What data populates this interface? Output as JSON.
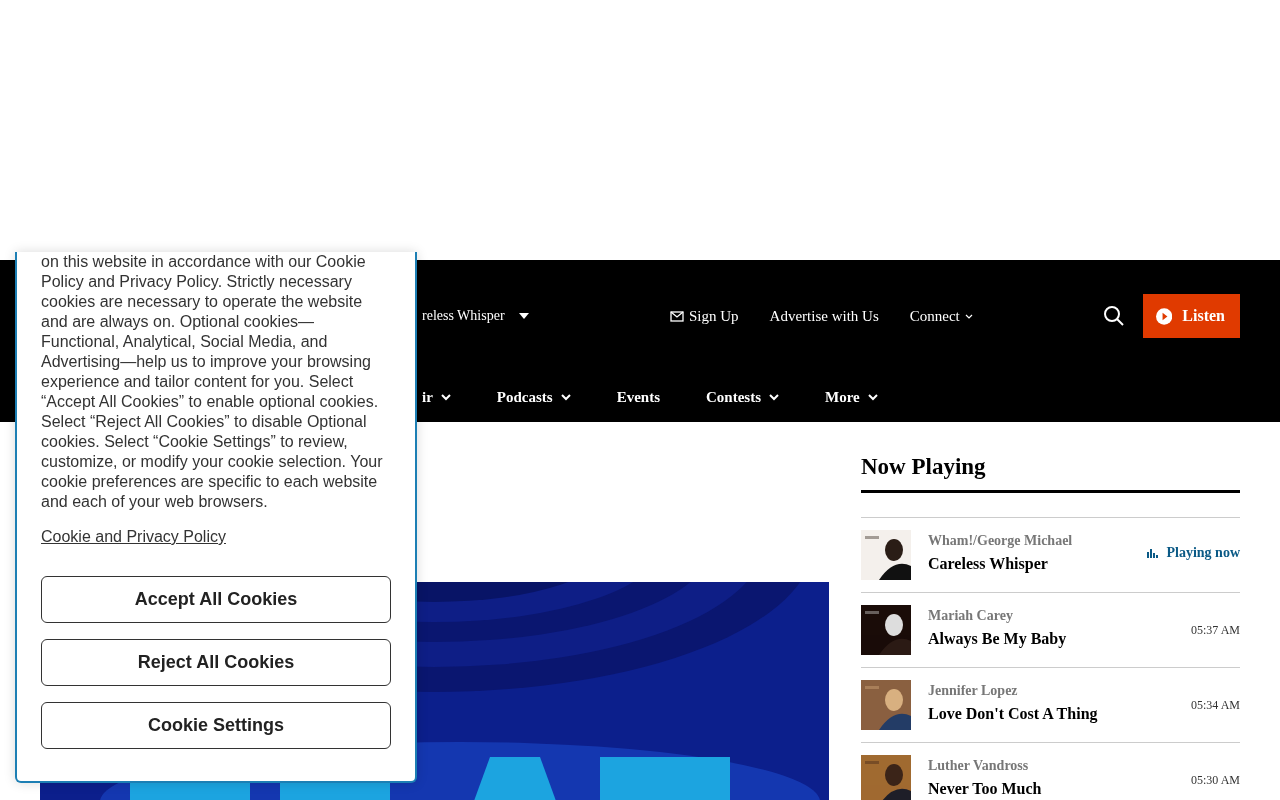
{
  "header": {
    "track": "reless Whisper",
    "links": [
      {
        "label": "Sign Up",
        "has_icon": true,
        "dropdown": false
      },
      {
        "label": "Advertise with Us",
        "has_icon": false,
        "dropdown": false
      },
      {
        "label": "Connect",
        "has_icon": false,
        "dropdown": true
      }
    ],
    "listen_button": "Listen"
  },
  "nav": [
    {
      "label": "ir",
      "dropdown": true
    },
    {
      "label": "Podcasts",
      "dropdown": true
    },
    {
      "label": "Events",
      "dropdown": false
    },
    {
      "label": "Contests",
      "dropdown": true
    },
    {
      "label": "More",
      "dropdown": true
    }
  ],
  "now_playing": {
    "title": "Now Playing",
    "tracks": [
      {
        "artist": "Wham!/George Michael",
        "title": "Careless Whisper",
        "playing": true,
        "status": "Playing now"
      },
      {
        "artist": "Mariah Carey",
        "title": "Always Be My Baby",
        "playing": false,
        "status": "05:37 AM"
      },
      {
        "artist": "Jennifer Lopez",
        "title": "Love Don't Cost A Thing",
        "playing": false,
        "status": "05:34 AM"
      },
      {
        "artist": "Luther Vandross",
        "title": "Never Too Much",
        "playing": false,
        "status": "05:30 AM"
      }
    ]
  },
  "cookie_banner": {
    "text": "on this website in accordance with our Cookie Policy and Privacy Policy. Strictly necessary cookies are necessary to operate the website and are always on. Optional cookies—Functional, Analytical, Social Media, and Advertising—help us to improve your browsing experience and tailor content for you. Select “Accept All Cookies” to enable optional cookies. Select “Reject All Cookies” to disable Optional cookies. Select “Cookie Settings” to review, customize, or modify your cookie selection. Your cookie preferences are specific to each website and each of your web browsers.",
    "policy_link": "Cookie and Privacy Policy",
    "buttons": [
      "Accept All Cookies",
      "Reject All Cookies",
      "Cookie Settings"
    ]
  }
}
